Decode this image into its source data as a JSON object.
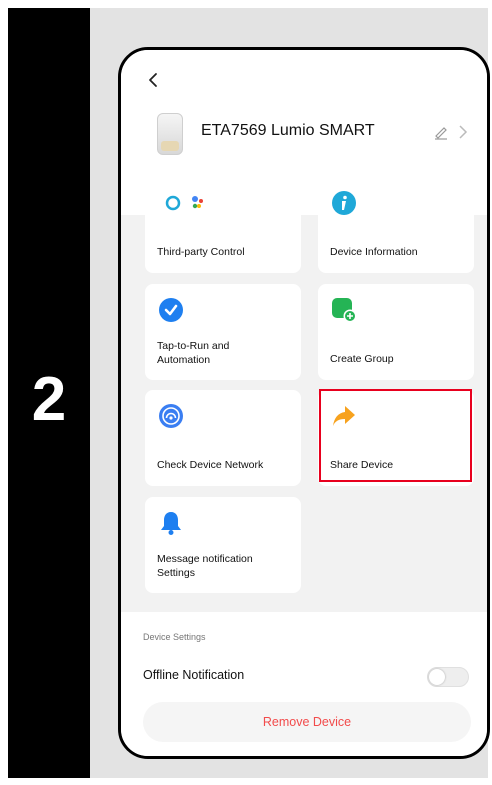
{
  "step": {
    "number": "2"
  },
  "header": {
    "device_title": "ETA7569 Lumio SMART"
  },
  "cards": [
    {
      "label": "Third-party Control",
      "icon": "alexa-google-assistant-icon"
    },
    {
      "label": "Device Information",
      "icon": "info-icon"
    },
    {
      "label": "Tap-to-Run and\nAutomation",
      "icon": "check-icon"
    },
    {
      "label": "Create Group",
      "icon": "create-group-icon"
    },
    {
      "label": "Check Device Network",
      "icon": "network-icon"
    },
    {
      "label": "Share Device",
      "icon": "share-arrow-icon"
    },
    {
      "label": "Message notification\nSettings",
      "icon": "bell-icon"
    }
  ],
  "settings": {
    "section_title": "Device Settings",
    "offline_label": "Offline Notification",
    "offline_enabled": false,
    "remove_label": "Remove Device"
  },
  "colors": {
    "highlight": "#e8001e",
    "remove_text": "#f24b4b",
    "icon_blue": "#1e7ff0",
    "icon_teal": "#1fa8d8",
    "icon_green": "#25b455",
    "icon_orange": "#f7a21e"
  }
}
